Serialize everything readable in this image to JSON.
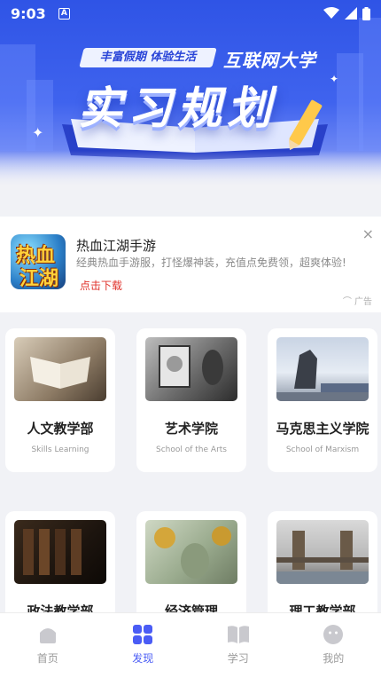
{
  "status": {
    "time": "9:03",
    "notif_icon": "a-icon"
  },
  "banner": {
    "slogan": "丰富假期 体验生活",
    "university": "互联网大学",
    "title": "实习规划"
  },
  "ad": {
    "icon_text": [
      "热血",
      "江湖"
    ],
    "title": "热血江湖手游",
    "description": "经典热血手游服，打怪爆神装，充值点免费领，超爽体验!",
    "cta": "点击下载",
    "tag": "广告",
    "close": "×"
  },
  "schools": [
    {
      "name": "人文教学部",
      "sub": "Skills Learning"
    },
    {
      "name": "艺术学院",
      "sub": "School of the Arts"
    },
    {
      "name": "马克思主义学院",
      "sub": "School of Marxism"
    },
    {
      "name": "政法教学部",
      "sub": ""
    },
    {
      "name": "经济管理",
      "sub": ""
    },
    {
      "name": "理工教学部",
      "sub": ""
    }
  ],
  "tabs": [
    {
      "label": "首页",
      "icon": "home-icon"
    },
    {
      "label": "发现",
      "icon": "discover-grid-icon"
    },
    {
      "label": "学习",
      "icon": "book-icon"
    },
    {
      "label": "我的",
      "icon": "profile-icon"
    }
  ],
  "colors": {
    "accent": "#4a5cf5",
    "banner": "#2f54e6",
    "cta": "#e0322b"
  }
}
